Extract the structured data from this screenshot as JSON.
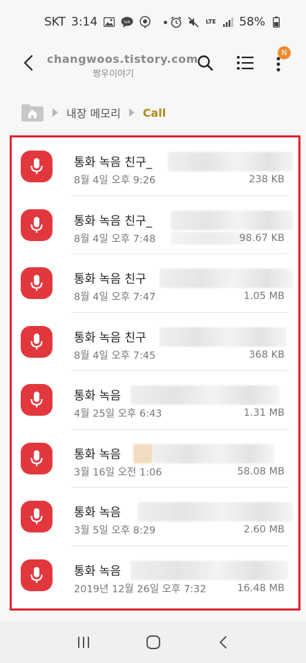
{
  "status_bar": {
    "carrier": "SKT",
    "time": "3:14",
    "network": "LTE",
    "battery": "58%"
  },
  "watermark": {
    "line1": "changwoos.tistory.com",
    "line2": "짱우이야기"
  },
  "app_bar": {
    "notification_badge": "N"
  },
  "breadcrumb": {
    "items": [
      "내장 메모리",
      "Call"
    ]
  },
  "files": [
    {
      "name": "통화 녹음 친구_",
      "date": "8월 4일 오후 9:26",
      "size": "238 KB"
    },
    {
      "name": "통화 녹음 친구_",
      "date": "8월 4일 오후 7:48",
      "size": "98.67 KB"
    },
    {
      "name": "통화 녹음 친구",
      "date": "8월 4일 오후 7:47",
      "size": "1.05 MB"
    },
    {
      "name": "통화 녹음 친구",
      "date": "8월 4일 오후 7:45",
      "size": "368 KB"
    },
    {
      "name": "통화 녹음",
      "date": "4월 25일 오후 6:43",
      "size": "1.31 MB"
    },
    {
      "name": "통화 녹음",
      "date": "3월 16일 오전 1:06",
      "size": "58.08 MB"
    },
    {
      "name": "통화 녹음",
      "date": "3월 5일 오후 8:29",
      "size": "2.60 MB"
    },
    {
      "name": "통화 녹음",
      "date": "2019년 12월 26일 오후 7:32",
      "size": "16.48 MB"
    }
  ],
  "colors": {
    "accent_red": "#e2383d",
    "highlight_border": "#e0202a",
    "breadcrumb_current": "#b08a1e",
    "badge": "#f08a2e"
  }
}
